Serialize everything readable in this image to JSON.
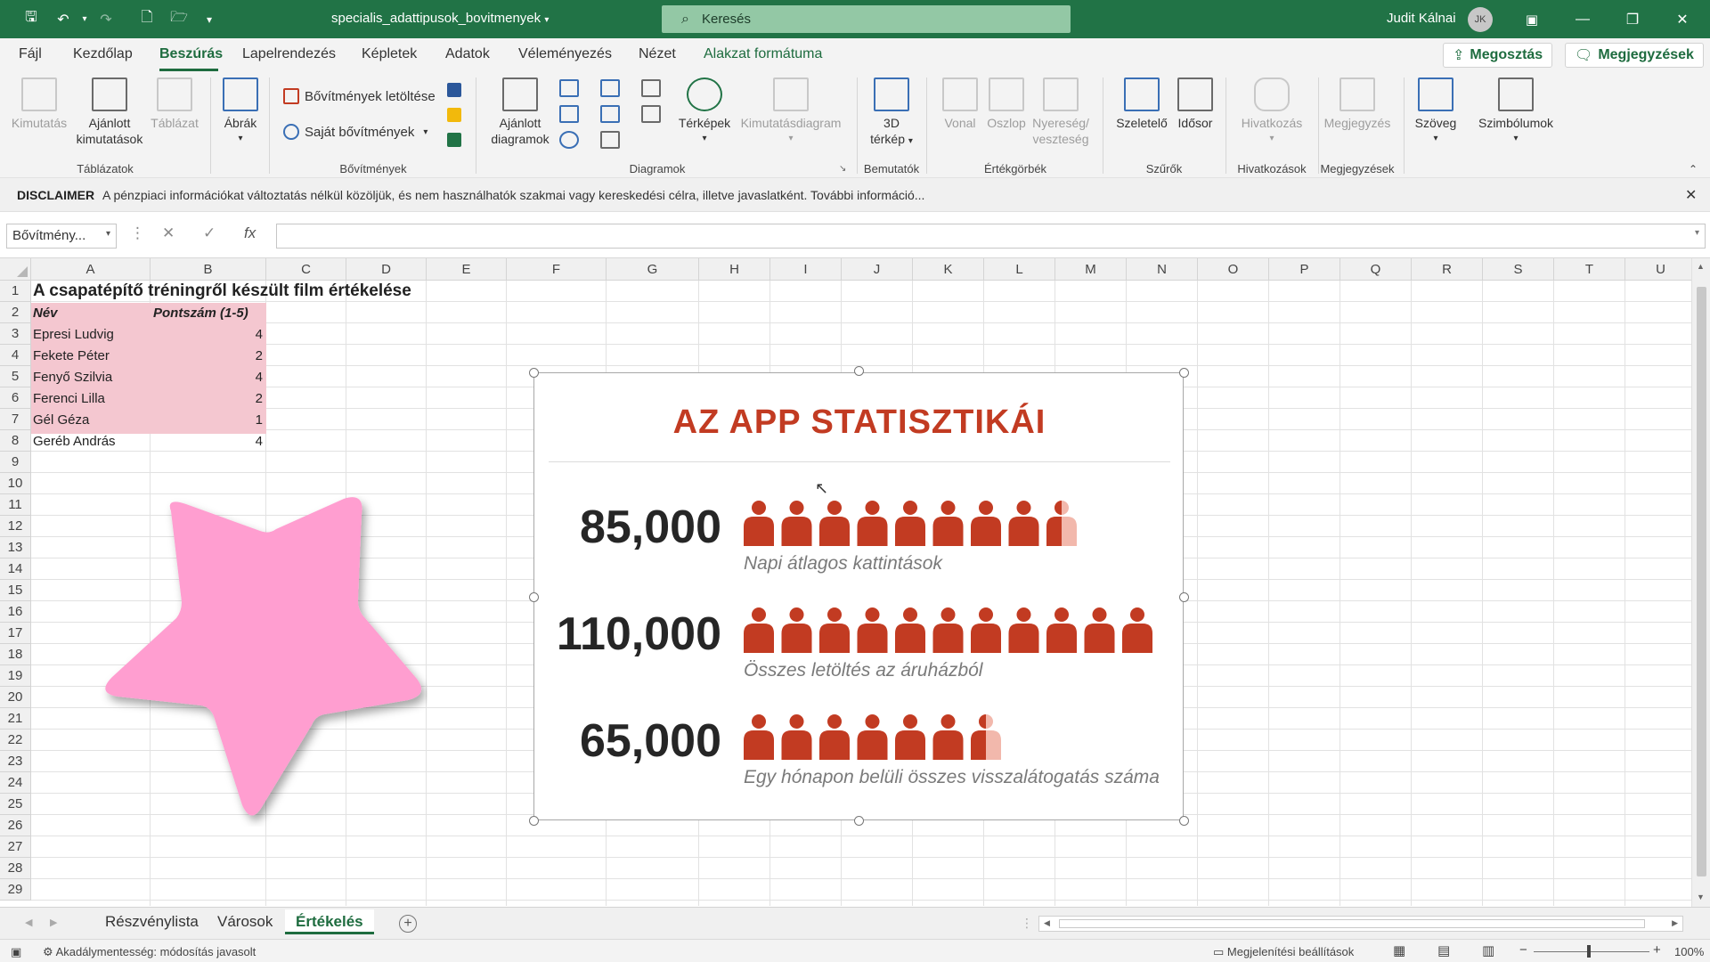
{
  "title_bar": {
    "document_title": "specialis_adattipusok_bovitmenyek",
    "search_placeholder": "Keresés",
    "user_name": "Judit Kálnai",
    "user_initials": "JK"
  },
  "menu": {
    "tabs": [
      "Fájl",
      "Kezdőlap",
      "Beszúrás",
      "Lapelrendezés",
      "Képletek",
      "Adatok",
      "Véleményezés",
      "Nézet",
      "Alakzat formátuma"
    ],
    "active_tab": "Beszúrás",
    "share_label": "Megosztás",
    "comments_label": "Megjegyzések"
  },
  "ribbon": {
    "tables_group": {
      "label": "Táblázatok",
      "pivot": "Kimutatás",
      "recommended_pivot_line1": "Ajánlott",
      "recommended_pivot_line2": "kimutatások",
      "table": "Táblázat"
    },
    "shapes": "Ábrák",
    "addins_group": {
      "label": "Bővítmények",
      "get_addins": "Bővítmények letöltése",
      "my_addins": "Saját bővítmények"
    },
    "charts_group": {
      "label": "Diagramok",
      "recommended_line1": "Ajánlott",
      "recommended_line2": "diagramok",
      "maps": "Térképek",
      "pivot_chart": "Kimutatásdiagram"
    },
    "tours_group": {
      "label": "Bemutatók",
      "map3d_line1": "3D",
      "map3d_line2": "térkép"
    },
    "sparklines_group": {
      "label": "Értékgörbék",
      "line": "Vonal",
      "column": "Oszlop",
      "winloss_line1": "Nyereség/",
      "winloss_line2": "veszteség"
    },
    "filters_group": {
      "label": "Szűrők",
      "slicer": "Szeletelő",
      "timeline": "Idősor"
    },
    "links_group": {
      "label": "Hivatkozások",
      "link": "Hivatkozás"
    },
    "comments_group": {
      "label": "Megjegyzések",
      "comment": "Megjegyzés"
    },
    "text": "Szöveg",
    "symbols": "Szimbólumok"
  },
  "disclaimer": {
    "title": "DISCLAIMER",
    "message": "A pénzpiaci információkat változtatás nélkül közöljük, és nem használhatók szakmai vagy kereskedési célra, illetve javaslatként. További információ..."
  },
  "formula_bar": {
    "name_box": "Bővítmény...",
    "fx": "fx",
    "value": ""
  },
  "sheet": {
    "columns": [
      "A",
      "B",
      "C",
      "D",
      "E",
      "F",
      "G",
      "H",
      "I",
      "J",
      "K",
      "L",
      "M",
      "N",
      "O",
      "P",
      "Q",
      "R",
      "S",
      "T",
      "U"
    ],
    "rows": [
      "1",
      "2",
      "3",
      "4",
      "5",
      "6",
      "7",
      "8",
      "9",
      "10",
      "11",
      "12",
      "13",
      "14",
      "15",
      "16",
      "17",
      "18",
      "19",
      "20",
      "21",
      "22",
      "23",
      "24",
      "25",
      "26",
      "27",
      "28",
      "29"
    ],
    "title": "A csapatépítő tréningről készült film értékelése",
    "header_name": "Név",
    "header_score": "Pontszám (1-5)",
    "entries": [
      {
        "name": "Epresi Ludvig",
        "score": "4"
      },
      {
        "name": "Fekete Péter",
        "score": "2"
      },
      {
        "name": "Fenyő Szilvia",
        "score": "4"
      },
      {
        "name": "Ferenci Lilla",
        "score": "2"
      },
      {
        "name": "Gél Géza",
        "score": "1"
      },
      {
        "name": "Geréb András",
        "score": "4"
      }
    ]
  },
  "infographic": {
    "title": "AZ APP STATISZTIKÁI",
    "accent_color": "#c23b22",
    "stats": [
      {
        "value": "85,000",
        "label": "Napi átlagos kattintások",
        "icons": 8.5
      },
      {
        "value": "110,000",
        "label": "Összes letöltés az áruházból",
        "icons": 11
      },
      {
        "value": "65,000",
        "label": "Egy hónapon belüli összes visszalátogatás száma",
        "icons": 6.5
      }
    ]
  },
  "sheet_tabs": {
    "tabs": [
      "Részvénylista",
      "Városok",
      "Értékelés"
    ],
    "active": "Értékelés"
  },
  "status_bar": {
    "accessibility": "Akadálymentesség: módosítás javasolt",
    "display_settings": "Megjelenítési beállítások",
    "zoom": "100%"
  }
}
